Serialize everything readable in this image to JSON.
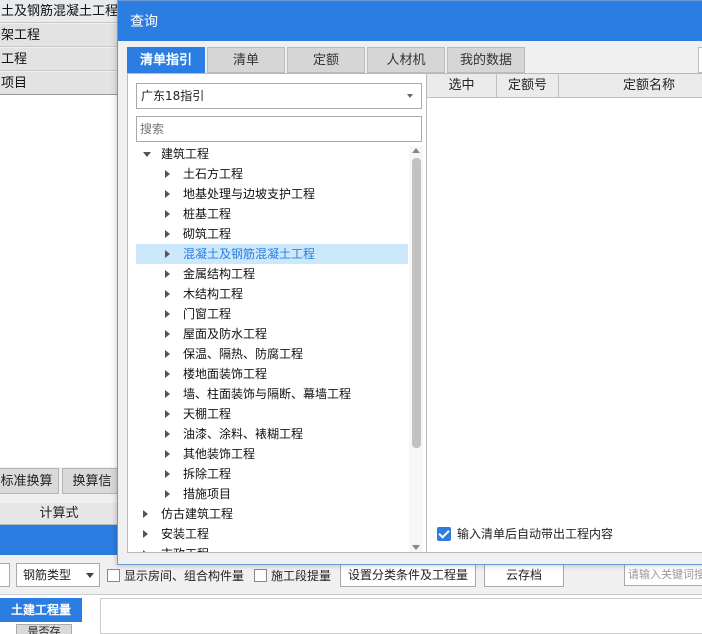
{
  "background": {
    "rows": [
      "土及钢筋混凝土工程",
      "架工程",
      "工程",
      "项目"
    ],
    "tabs": [
      "标准换算",
      "换算信"
    ],
    "formula_header": "计算式"
  },
  "toolbar": {
    "rebar_type": "钢筋类型",
    "show_rooms_label": "显示房间、组合构件量",
    "stage_extract_label": "施工段提量",
    "set_conditions_button": "设置分类条件及工程量",
    "cloud_save_button": "云存档",
    "keyword_placeholder": "请输入关键词搜"
  },
  "bottom": {
    "active_tab": "土建工程量",
    "sub_tab": "是否存"
  },
  "dialog": {
    "title": "查询",
    "tabs": [
      "清单指引",
      "清单",
      "定额",
      "人材机",
      "我的数据"
    ],
    "active_tab_index": 0,
    "guide_select": "广东18指引",
    "search_placeholder": "搜索",
    "tree": [
      {
        "label": "建筑工程",
        "level": 0,
        "expanded": true
      },
      {
        "label": "土石方工程",
        "level": 1
      },
      {
        "label": "地基处理与边坡支护工程",
        "level": 1
      },
      {
        "label": "桩基工程",
        "level": 1
      },
      {
        "label": "砌筑工程",
        "level": 1
      },
      {
        "label": "混凝土及钢筋混凝土工程",
        "level": 1,
        "selected": true
      },
      {
        "label": "金属结构工程",
        "level": 1
      },
      {
        "label": "木结构工程",
        "level": 1
      },
      {
        "label": "门窗工程",
        "level": 1
      },
      {
        "label": "屋面及防水工程",
        "level": 1
      },
      {
        "label": "保温、隔热、防腐工程",
        "level": 1
      },
      {
        "label": "楼地面装饰工程",
        "level": 1
      },
      {
        "label": "墙、柱面装饰与隔断、幕墙工程",
        "level": 1
      },
      {
        "label": "天棚工程",
        "level": 1
      },
      {
        "label": "油漆、涂料、裱糊工程",
        "level": 1
      },
      {
        "label": "其他装饰工程",
        "level": 1
      },
      {
        "label": "拆除工程",
        "level": 1
      },
      {
        "label": "措施项目",
        "level": 1
      },
      {
        "label": "仿古建筑工程",
        "level": 0
      },
      {
        "label": "安装工程",
        "level": 0
      },
      {
        "label": "市政工程",
        "level": 0
      }
    ],
    "grid_columns": [
      "选中",
      "定额号",
      "定额名称"
    ],
    "auto_bring_label": "输入清单后自动带出工程内容",
    "auto_bring_checked": true
  },
  "colors": {
    "accent": "#2b7de1",
    "selection_bg": "#cce8fb"
  }
}
